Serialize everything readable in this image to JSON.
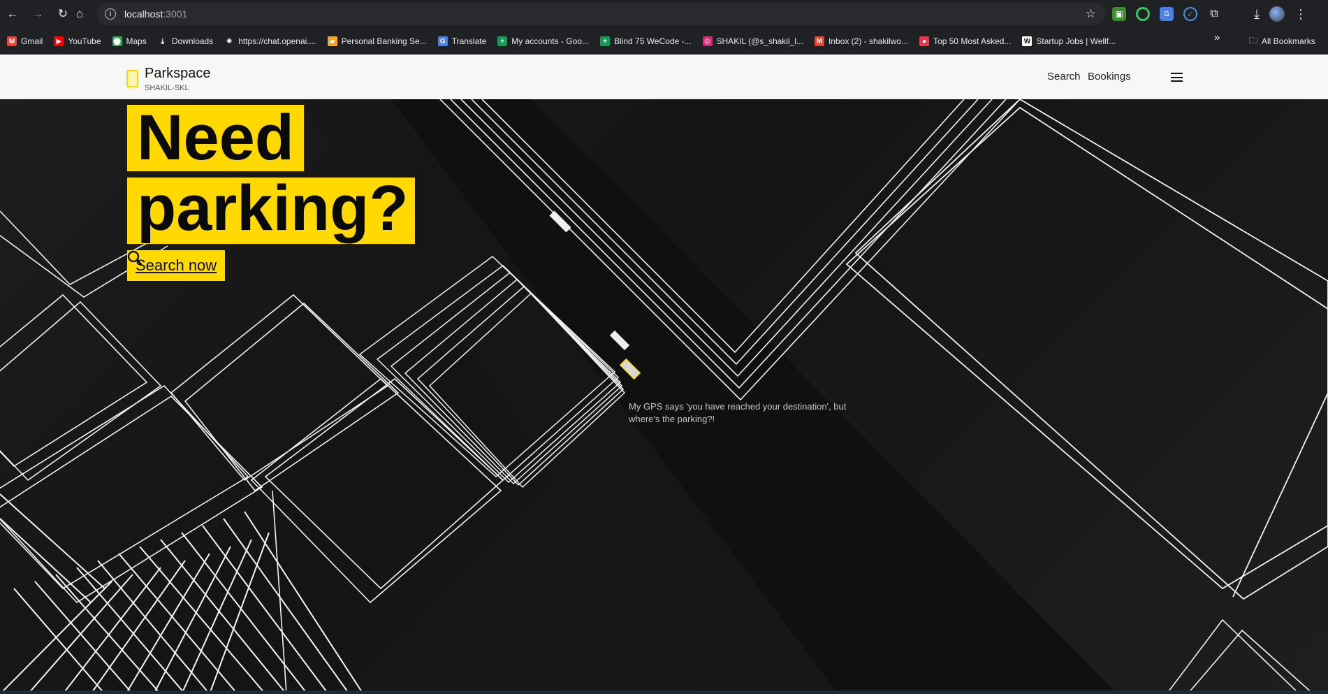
{
  "browser": {
    "url_host": "localhost",
    "url_port": ":3001",
    "bookmarks": [
      {
        "label": "Gmail",
        "icon": "gmail-icon",
        "color": "#ea4335",
        "glyph": "M"
      },
      {
        "label": "YouTube",
        "icon": "youtube-icon",
        "color": "#ff0000",
        "glyph": "▶"
      },
      {
        "label": "Maps",
        "icon": "maps-icon",
        "color": "#34a853",
        "glyph": "⬤"
      },
      {
        "label": "Downloads",
        "icon": "download-icon",
        "color": "#202124",
        "glyph": "⤓"
      },
      {
        "label": "https://chat.openai....",
        "icon": "openai-icon",
        "color": "#202124",
        "glyph": "✺"
      },
      {
        "label": "Personal Banking Se...",
        "icon": "bank-icon",
        "color": "#f5a623",
        "glyph": "▰"
      },
      {
        "label": "Translate",
        "icon": "translate-icon",
        "color": "#4a80e8",
        "glyph": "G"
      },
      {
        "label": "My accounts - Goo...",
        "icon": "sheets-icon",
        "color": "#0f9d58",
        "glyph": "+"
      },
      {
        "label": "Blind 75 WeCode -...",
        "icon": "sheets-icon",
        "color": "#0f9d58",
        "glyph": "+"
      },
      {
        "label": "SHAKIL (@s_shakil_l...",
        "icon": "instagram-icon",
        "color": "#d62976",
        "glyph": "◎"
      },
      {
        "label": "Inbox (2) - shakilwo...",
        "icon": "gmail-icon",
        "color": "#ea4335",
        "glyph": "M"
      },
      {
        "label": "Top 50 Most Asked...",
        "icon": "site-icon",
        "color": "#e53950",
        "glyph": "●"
      },
      {
        "label": "Startup Jobs | Wellf...",
        "icon": "wellfound-icon",
        "color": "#ffffff",
        "glyph": "W"
      }
    ],
    "all_bookmarks": "All Bookmarks"
  },
  "header": {
    "brand": "Parkspace",
    "subtitle": "SHAKIL-SKL",
    "nav": [
      "Search",
      "Bookings"
    ]
  },
  "hero": {
    "headline_line1": "Need",
    "headline_line2": "parking?",
    "cta": "Search now",
    "caption": "My GPS says 'you have reached your destination', but where's the parking?!",
    "accent": "#ffd900"
  }
}
